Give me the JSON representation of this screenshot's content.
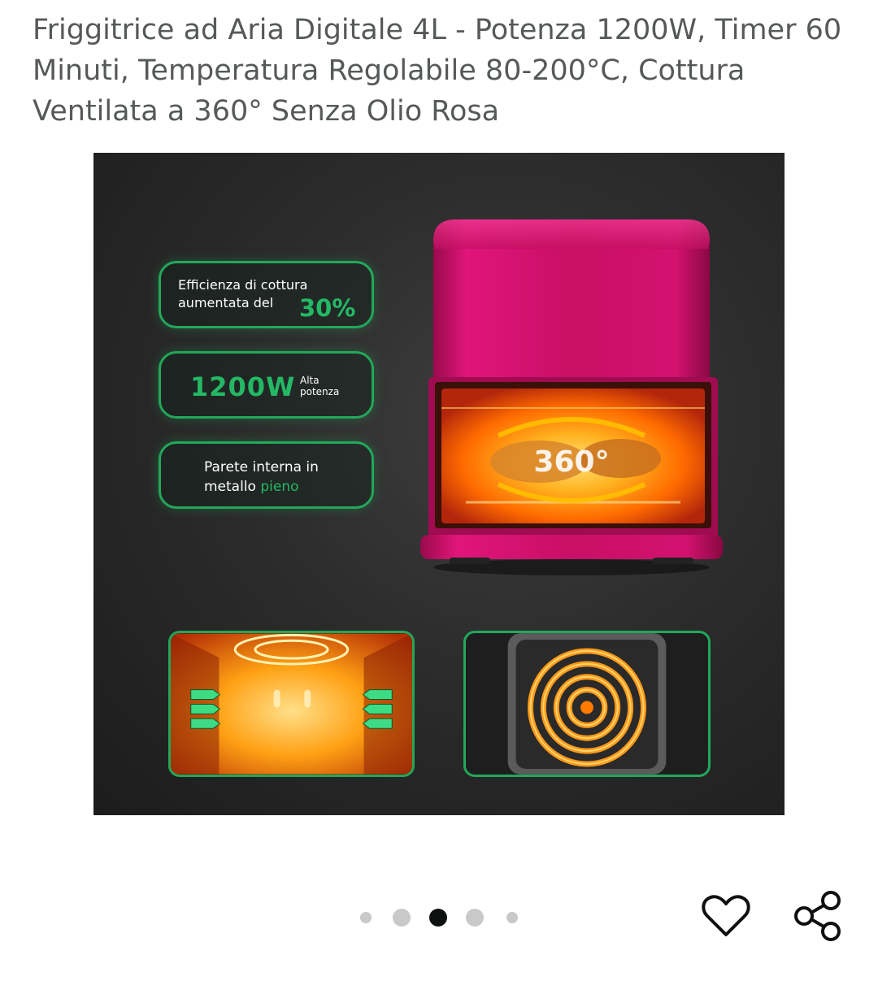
{
  "product": {
    "title": "Friggitrice ad Aria Digitale 4L - Potenza 1200W, Timer 60 Minuti, Temperatura Regolabile 80-200°C, Cottura Ventilata a 360° Senza Olio Rosa"
  },
  "image_overlay": {
    "callout_efficiency": {
      "line1": "Efficienza di cottura",
      "line2": "aumentata del",
      "value": "30%"
    },
    "callout_power": {
      "value": "1200W",
      "label_line1": "Alta",
      "label_line2": "potenza"
    },
    "callout_wall": {
      "line1": "Parete interna in",
      "line2_prefix": "metallo",
      "line2_highlight": "pieno"
    },
    "badge_360": "360°"
  },
  "carousel": {
    "total": 5,
    "active_index": 3
  },
  "icons": {
    "favorite": "heart-icon",
    "share": "share-icon"
  },
  "colors": {
    "accent_green": "#24b865",
    "fryer_pink": "#d8126f",
    "title_text": "#565959",
    "dot_active": "#0f1111",
    "dot_inactive": "#c9c9c9"
  }
}
